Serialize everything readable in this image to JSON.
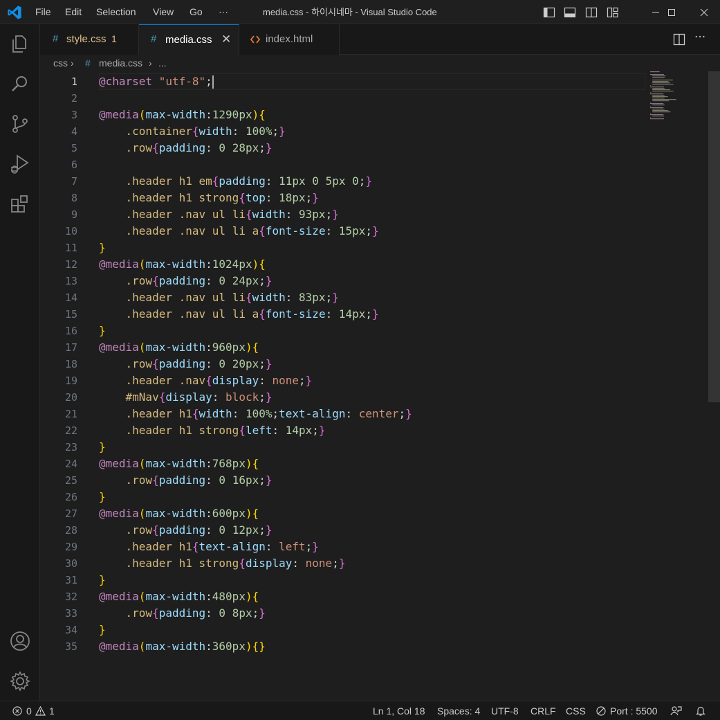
{
  "titlebar": {
    "menus": [
      "File",
      "Edit",
      "Selection",
      "View",
      "Go",
      "···"
    ],
    "title": "media.css - 하이시네마 - Visual Studio Code"
  },
  "tabs": [
    {
      "label": "style.css",
      "badge": "1",
      "color": "#e2c08d",
      "icon": "css-hash-icon"
    },
    {
      "label": "media.css",
      "active": true,
      "icon": "css-hash-icon"
    },
    {
      "label": "index.html",
      "icon": "html-icon"
    }
  ],
  "breadcrumb": {
    "folder": "css",
    "file": "media.css",
    "more": "..."
  },
  "editor": {
    "line_numbers": [
      "1",
      "2",
      "3",
      "4",
      "5",
      "6",
      "7",
      "8",
      "9",
      "10",
      "11",
      "12",
      "13",
      "14",
      "15",
      "16",
      "17",
      "18",
      "19",
      "20",
      "21",
      "22",
      "23",
      "24",
      "25",
      "26",
      "27",
      "28",
      "29",
      "30",
      "31",
      "32",
      "33",
      "34",
      "35"
    ],
    "lines": [
      "@charset \"utf-8\";",
      "",
      "@media(max-width:1290px){",
      "    .container{width: 100%;}",
      "    .row{padding: 0 28px;}",
      "",
      "    .header h1 em{padding: 11px 0 5px 0;}",
      "    .header h1 strong{top: 18px;}",
      "    .header .nav ul li{width: 93px;}",
      "    .header .nav ul li a{font-size: 15px;}",
      "}",
      "@media(max-width:1024px){",
      "    .row{padding: 0 24px;}",
      "    .header .nav ul li{width: 83px;}",
      "    .header .nav ul li a{font-size: 14px;}",
      "}",
      "@media(max-width:960px){",
      "    .row{padding: 0 20px;}",
      "    .header .nav{display: none;}",
      "    #mNav{display: block;}",
      "    .header h1{width: 100%;text-align: center;}",
      "    .header h1 strong{left: 14px;}",
      "}",
      "@media(max-width:768px){",
      "    .row{padding: 0 16px;}",
      "}",
      "@media(max-width:600px){",
      "    .row{padding: 0 12px;}",
      "    .header h1{text-align: left;}",
      "    .header h1 strong{display: none;}",
      "}",
      "@media(max-width:480px){",
      "    .row{padding: 0 8px;}",
      "}",
      "@media(max-width:360px){}"
    ]
  },
  "statusbar": {
    "errors": "0",
    "warnings": "1",
    "position": "Ln 1, Col 18",
    "spaces": "Spaces: 4",
    "encoding": "UTF-8",
    "eol": "CRLF",
    "language": "CSS",
    "port": "Port : 5500"
  }
}
